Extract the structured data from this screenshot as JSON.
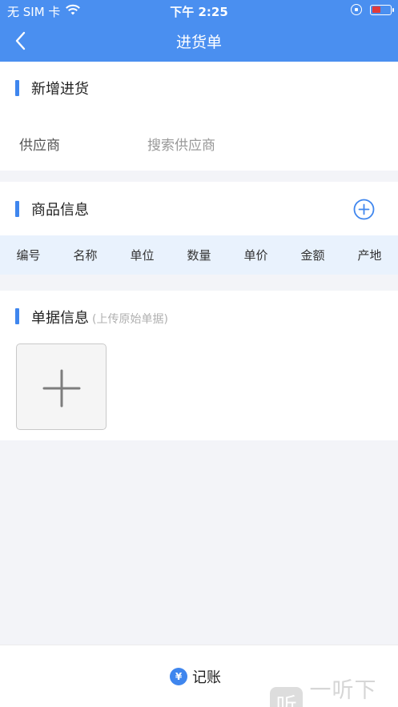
{
  "status_bar": {
    "carrier": "无 SIM 卡",
    "time": "下午 2:25",
    "icons": [
      "wifi-icon",
      "orientation-lock-icon",
      "battery-icon"
    ],
    "battery_level": 0.5
  },
  "nav": {
    "title": "进货单",
    "back_icon": "chevron-left-icon"
  },
  "section_new": {
    "title": "新增进货",
    "supplier_label": "供应商",
    "supplier_placeholder": "搜索供应商"
  },
  "section_goods": {
    "title": "商品信息",
    "add_icon": "plus-circle-icon",
    "columns": [
      "编号",
      "名称",
      "单位",
      "数量",
      "单价",
      "金额",
      "产地"
    ]
  },
  "section_docs": {
    "title": "单据信息",
    "hint": "(上传原始单据)",
    "upload_icon": "plus-icon"
  },
  "footer": {
    "account_label": "记账",
    "account_icon": "yen-icon"
  },
  "watermark": {
    "logo_char": "听",
    "text": "一听下载"
  },
  "colors": {
    "primary": "#4a8ff0",
    "accent_bar": "#3f86ee",
    "table_header_bg": "#e9f2fd",
    "page_bg": "#f3f4f8"
  }
}
